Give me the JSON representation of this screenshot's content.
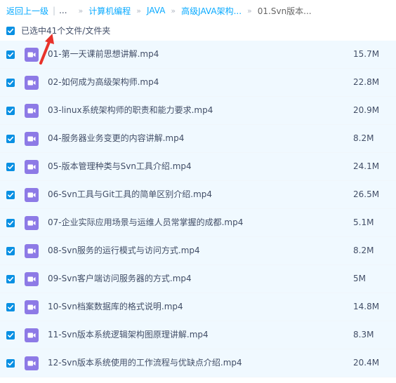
{
  "breadcrumb": {
    "back_label": "返回上一级",
    "separator": "|",
    "ellipsis": "...",
    "arrow": "»",
    "items": [
      "计算机编程",
      "JAVA",
      "高级JAVA架构...",
      "01.Svn版本..."
    ]
  },
  "selection": {
    "summary": "已选中41个文件/文件夹",
    "checked": true
  },
  "files": [
    {
      "name": "01-第一天课前思想讲解.mp4",
      "size": "15.7M",
      "checked": true
    },
    {
      "name": "02-如何成为高级架构师.mp4",
      "size": "22.8M",
      "checked": true
    },
    {
      "name": "03-linux系统架构师的职责和能力要求.mp4",
      "size": "20.9M",
      "checked": true
    },
    {
      "name": "04-服务器业务变更的内容讲解.mp4",
      "size": "8.2M",
      "checked": true
    },
    {
      "name": "05-版本管理种类与Svn工具介绍.mp4",
      "size": "24.1M",
      "checked": true
    },
    {
      "name": "06-Svn工具与Git工具的简单区别介绍.mp4",
      "size": "26.5M",
      "checked": true
    },
    {
      "name": "07-企业实际应用场景与运维人员常掌握的成都.mp4",
      "size": "5.1M",
      "checked": true
    },
    {
      "name": "08-Svn服务的运行模式与访问方式.mp4",
      "size": "8.2M",
      "checked": true
    },
    {
      "name": "09-Svn客户端访问服务器的方式.mp4",
      "size": "5M",
      "checked": true
    },
    {
      "name": "10-Svn档案数据库的格式说明.mp4",
      "size": "14.8M",
      "checked": true
    },
    {
      "name": "11-Svn版本系统逻辑架构图原理讲解.mp4",
      "size": "8.3M",
      "checked": true
    },
    {
      "name": "12-Svn版本系统使用的工作流程与优缺点介绍.mp4",
      "size": "20.4M",
      "checked": true
    }
  ],
  "icons": {
    "checkbox": "checkbox-checked-icon",
    "file": "video-file-icon",
    "annotation": "red-arrow-annotation"
  },
  "colors": {
    "link": "#09aaff",
    "text": "#424e67",
    "checkbox": "#0990e3",
    "row_selected_bg": "#f0f9ff",
    "video_icon": "#8d7ae6",
    "annotation": "#e8322a"
  }
}
